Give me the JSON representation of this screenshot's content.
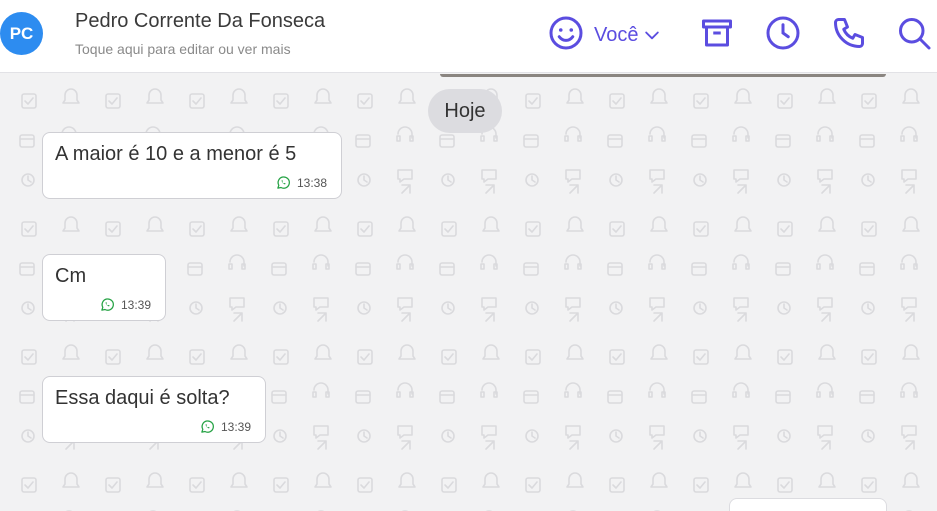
{
  "header": {
    "avatar_initials": "PC",
    "contact_name": "Pedro Corrente Da Fonseca",
    "contact_subtitle": "Toque aqui para editar ou ver mais",
    "agent_label": "Você",
    "accent_color": "#5b4de0",
    "icons": [
      "smile-icon",
      "chevron-down-icon",
      "archive-icon",
      "clock-icon",
      "phone-icon",
      "search-icon"
    ]
  },
  "chat": {
    "date_divider": "Hoje",
    "messages": [
      {
        "text": "A maior é 10 e a menor é 5",
        "time": "13:38",
        "channel_icon": "whatsapp-icon"
      },
      {
        "text": "Cm",
        "time": "13:39",
        "channel_icon": "whatsapp-icon"
      },
      {
        "text": "Essa daqui é solta?",
        "time": "13:39",
        "channel_icon": "whatsapp-icon"
      }
    ]
  }
}
